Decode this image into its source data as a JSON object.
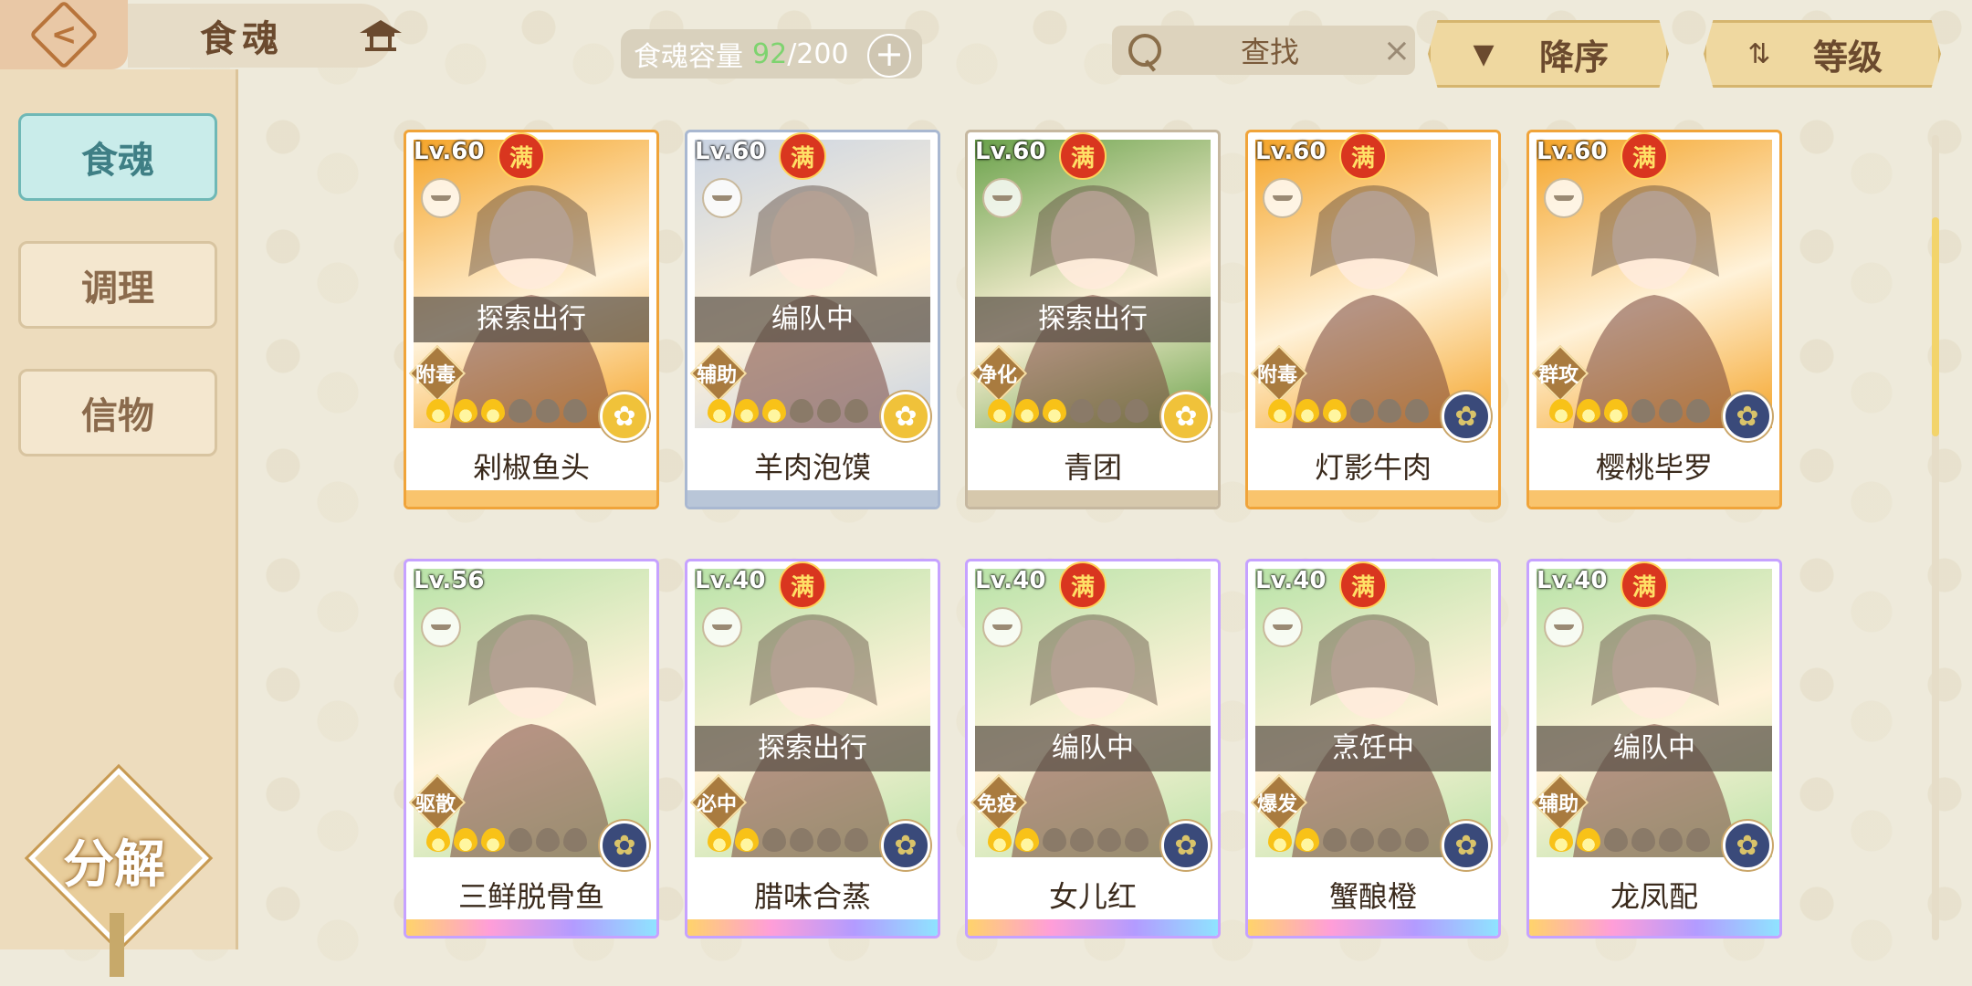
{
  "header": {
    "back_label": "<",
    "title": "食魂",
    "capacity_label": "食魂容量",
    "capacity_current": "92",
    "capacity_max": "/200",
    "capacity_plus": "+",
    "search_placeholder": "查找",
    "search_clear": "×",
    "sort_order_label": "降序",
    "sort_order_icon": "▼",
    "sort_field_label": "等级",
    "sort_field_icon": "⇅"
  },
  "sidebar": {
    "items": [
      {
        "label": "食魂",
        "active": true
      },
      {
        "label": "调理",
        "active": false
      },
      {
        "label": "信物",
        "active": false
      }
    ],
    "decompose_label": "分解"
  },
  "cards": [
    {
      "level": "Lv.60",
      "max": "满",
      "status": "探索出行",
      "tag": "附毒",
      "flames_on": 3,
      "flames_total": 6,
      "medal": "gold",
      "name": "剁椒鱼头",
      "rarity": "sr",
      "bg": "#f5a52a",
      "strip": "#f9c46d"
    },
    {
      "level": "Lv.60",
      "max": "满",
      "status": "编队中",
      "tag": "辅助",
      "flames_on": 3,
      "flames_total": 6,
      "medal": "gold",
      "name": "羊肉泡馍",
      "rarity": "r",
      "bg": "#c9d3e2",
      "strip": "#b9c6d8"
    },
    {
      "level": "Lv.60",
      "max": "满",
      "status": "探索出行",
      "tag": "净化",
      "flames_on": 3,
      "flames_total": 6,
      "medal": "gold",
      "name": "青团",
      "rarity": "gold-r",
      "bg": "#6aa24b",
      "strip": "#d6c8ac"
    },
    {
      "level": "Lv.60",
      "max": "满",
      "status": "",
      "tag": "附毒",
      "flames_on": 3,
      "flames_total": 6,
      "medal": "blue",
      "name": "灯影牛肉",
      "rarity": "sr",
      "bg": "#f5a52a",
      "strip": "#f9c46d"
    },
    {
      "level": "Lv.60",
      "max": "满",
      "status": "",
      "tag": "群攻",
      "flames_on": 3,
      "flames_total": 6,
      "medal": "blue",
      "name": "樱桃毕罗",
      "rarity": "sr",
      "bg": "#f5a52a",
      "strip": "#f9c46d"
    },
    {
      "level": "Lv.56",
      "max": "",
      "status": "",
      "tag": "驱散",
      "flames_on": 3,
      "flames_total": 6,
      "medal": "blue",
      "name": "三鲜脱骨鱼",
      "rarity": "ur",
      "bg": "#b9e3a8",
      "strip": "#e7b4ff"
    },
    {
      "level": "Lv.40",
      "max": "满",
      "status": "探索出行",
      "tag": "必中",
      "flames_on": 2,
      "flames_total": 6,
      "medal": "blue",
      "name": "腊味合蒸",
      "rarity": "ur",
      "bg": "#b9e3a8",
      "strip": "#e7b4ff"
    },
    {
      "level": "Lv.40",
      "max": "满",
      "status": "编队中",
      "tag": "免疫",
      "flames_on": 2,
      "flames_total": 6,
      "medal": "blue",
      "name": "女儿红",
      "rarity": "ur",
      "bg": "#b9e3a8",
      "strip": "#e7b4ff"
    },
    {
      "level": "Lv.40",
      "max": "满",
      "status": "烹饪中",
      "tag": "爆发",
      "flames_on": 2,
      "flames_total": 6,
      "medal": "blue",
      "name": "蟹酿橙",
      "rarity": "ur",
      "bg": "#b9e3a8",
      "strip": "#e7b4ff"
    },
    {
      "level": "Lv.40",
      "max": "满",
      "status": "编队中",
      "tag": "辅助",
      "flames_on": 2,
      "flames_total": 6,
      "medal": "blue",
      "name": "龙凤配",
      "rarity": "ur",
      "bg": "#b9e3a8",
      "strip": "#e7b4ff"
    }
  ]
}
